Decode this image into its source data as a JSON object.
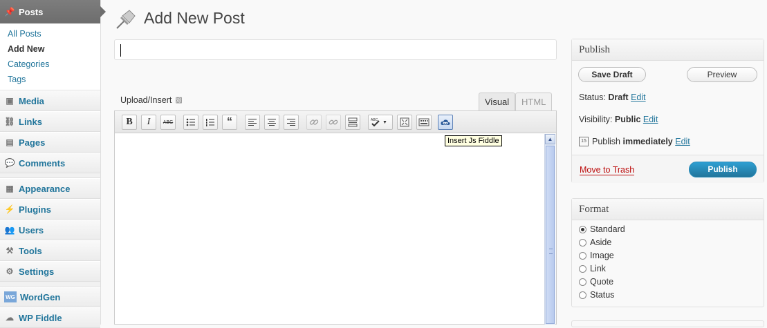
{
  "sidebar": {
    "posts": "Posts",
    "submenu": [
      "All Posts",
      "Add New",
      "Categories",
      "Tags"
    ],
    "media": "Media",
    "links": "Links",
    "pages": "Pages",
    "comments": "Comments",
    "appearance": "Appearance",
    "plugins": "Plugins",
    "users": "Users",
    "tools": "Tools",
    "settings": "Settings",
    "wordgen": "WordGen",
    "wordgen_badge": "WG",
    "wpfiddle": "WP Fiddle"
  },
  "header": {
    "title": "Add New Post"
  },
  "title_input": {
    "value": ""
  },
  "editor": {
    "upload_label": "Upload/Insert",
    "tab_visual": "Visual",
    "tab_html": "HTML",
    "tooltip": "Insert Js Fiddle",
    "toolbar": {
      "bold": "B",
      "italic": "I",
      "strike": "ABC",
      "quote": "“"
    }
  },
  "publish": {
    "heading": "Publish",
    "save_draft": "Save Draft",
    "preview": "Preview",
    "status_label": "Status:",
    "status_value": "Draft",
    "visibility_label": "Visibility:",
    "visibility_value": "Public",
    "publish_label": "Publish",
    "publish_value": "immediately",
    "edit": "Edit",
    "trash": "Move to Trash",
    "publish_button": "Publish"
  },
  "format": {
    "heading": "Format",
    "options": [
      "Standard",
      "Aside",
      "Image",
      "Link",
      "Quote",
      "Status"
    ],
    "selected": "Standard"
  }
}
